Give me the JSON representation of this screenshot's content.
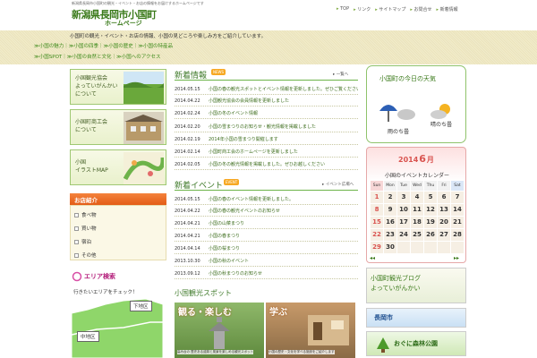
{
  "header": {
    "tagline": "新潟県長岡市小国町の観光・イベント・お店の情報をお届けするホームページです",
    "title": "新潟県長岡市小国町",
    "subtitle": "ホームページ",
    "nav": [
      "TOP",
      "リンク",
      "サイトマップ",
      "お問合せ",
      "新着情報"
    ]
  },
  "band": {
    "intro": "小国町の観光・イベント・お店の情報、小国の見どころや楽しみ方をご紹介しています。",
    "quick1": "≫小国の魅力｜≫小国の四季｜≫小国の歴史｜≫小国の特産品",
    "quick2": "≫小国SPOT｜≫小国の自然と文化｜≫小国へのアクセス"
  },
  "left": {
    "banners": [
      {
        "label": "小国観光協会\nよっていがんかい\nについて"
      },
      {
        "label": "小国町商工会\nについて"
      },
      {
        "label": "小国\nイラストMAP"
      }
    ],
    "shop_title": "お店紹介",
    "shops": [
      "食べ物",
      "買い物",
      "宿泊",
      "その他"
    ],
    "area_title": "エリア検索",
    "area_desc": "行きたいエリアをチェック！",
    "area_upper": "下地区",
    "area_middle": "中地区"
  },
  "news": {
    "title": "新着情報",
    "badge": "NEWS",
    "more": "▸ 一覧へ",
    "items": [
      {
        "date": "2014.05.15",
        "text": "小国の春の観光スポットとイベント情報を更新しました。ぜひご覧ください"
      },
      {
        "date": "2014.04.22",
        "text": "小国観光協会の会員情報を更新しました"
      },
      {
        "date": "2014.02.24",
        "text": "小国の冬のイベント情報"
      },
      {
        "date": "2014.02.20",
        "text": "小国の雪まつりのお知らせ・観光情報を掲載しました"
      },
      {
        "date": "2014.02.19",
        "text": "2014年小国の雪まつり開催します"
      },
      {
        "date": "2014.02.14",
        "text": "小国町商工会のホームページを更新しました"
      },
      {
        "date": "2014.02.05",
        "text": "小国の冬の観光情報を掲載しました。ぜひお越しください"
      }
    ]
  },
  "events": {
    "title": "新着イベント",
    "badge": "EVENT",
    "more": "▸ イベント広場へ",
    "items": [
      {
        "date": "2014.05.15",
        "text": "小国の春のイベント情報を更新しました。"
      },
      {
        "date": "2014.04.22",
        "text": "小国の春の観光イベントのお知らせ"
      },
      {
        "date": "2014.04.21",
        "text": "小国の山菜まつり"
      },
      {
        "date": "2014.04.21",
        "text": "小国の春まつり"
      },
      {
        "date": "2014.04.14",
        "text": "小国の桜まつり"
      },
      {
        "date": "2013.10.30",
        "text": "小国の秋のイベント"
      },
      {
        "date": "2013.09.12",
        "text": "小国の秋まつりのお知らせ"
      }
    ]
  },
  "kanko": {
    "title": "小国観光スポット",
    "cards": [
      {
        "label": "観る・楽しむ",
        "caption": "高み台の 歴史ある遺跡と風景を楽しめる観光スポット"
      },
      {
        "label": "学ぶ",
        "caption": "小国の歴史・文化を学べる施設をご紹介します"
      }
    ]
  },
  "weather": {
    "title": "小国町の今日の天気",
    "today": "雨のち曇",
    "tomorrow": "晴のち曇"
  },
  "calendar": {
    "year": "2014",
    "month": "6",
    "unit": "月",
    "header": "小国のイベントカレンダー",
    "weekdays": [
      "Sun",
      "Mon",
      "Tue",
      "Wed",
      "Thu",
      "Fri",
      "Sat"
    ],
    "weeks": [
      [
        "1",
        "2",
        "3",
        "4",
        "5",
        "6",
        "7"
      ],
      [
        "8",
        "9",
        "10",
        "11",
        "12",
        "13",
        "14"
      ],
      [
        "15",
        "16",
        "17",
        "18",
        "19",
        "20",
        "21"
      ],
      [
        "22",
        "23",
        "24",
        "25",
        "26",
        "27",
        "28"
      ],
      [
        "29",
        "30",
        "",
        "",
        "",
        "",
        ""
      ]
    ]
  },
  "right_banners": [
    {
      "label": "小国町観光ブログ\nよっていがんかい"
    },
    {
      "label": "長岡市"
    },
    {
      "label": "おぐに森林公園"
    }
  ],
  "colors": {
    "accent_green": "#3a7a1a",
    "orange": "#f4823c",
    "pink": "#b4217c"
  }
}
